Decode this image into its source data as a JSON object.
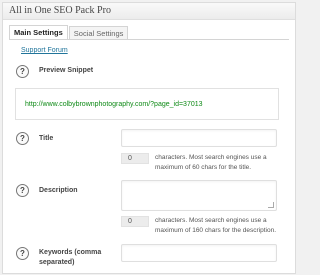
{
  "panel": {
    "title": "All in One SEO Pack Pro"
  },
  "tabs": [
    {
      "label": "Main Settings",
      "active": true
    },
    {
      "label": "Social Settings",
      "active": false
    }
  ],
  "support_link": "Support Forum",
  "help_glyph": "?",
  "preview": {
    "label": "Preview Snippet",
    "url": "http://www.colbybrownphotography.com/?page_id=37013"
  },
  "title_field": {
    "label": "Title",
    "value": "",
    "count": "0",
    "note_line1": "characters. Most search engines use a",
    "note_line2": "maximum of 60 chars for the title."
  },
  "description_field": {
    "label": "Description",
    "value": "",
    "count": "0",
    "note_line1": "characters. Most search engines use a",
    "note_line2": "maximum of 160 chars for the description."
  },
  "keywords_field": {
    "label_line1": "Keywords (comma",
    "label_line2": "separated)",
    "value": ""
  },
  "colors": {
    "link": "#21759b",
    "url": "#0e8a16"
  }
}
